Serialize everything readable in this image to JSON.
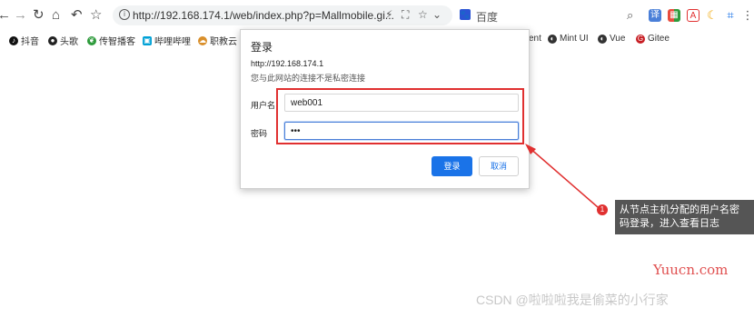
{
  "toolbar": {
    "url": "http://192.168.174.1/web/index.php?p=Mallmobile.gi...",
    "search_text": "百度"
  },
  "bookmarks": [
    {
      "label": "抖音",
      "color": "#111111",
      "icon": "douyin-icon"
    },
    {
      "label": "头歌",
      "color": "#222222",
      "icon": "github-icon"
    },
    {
      "label": "传智播客",
      "color": "#2e9b3c",
      "icon": "leaf-icon"
    },
    {
      "label": "哔哩哔哩",
      "color": "#00a1d6",
      "icon": "bilibili-icon"
    },
    {
      "label": "职教云",
      "color": "#d98f2b",
      "icon": "cloud-icon"
    },
    {
      "label": "ent",
      "color": "#333333",
      "icon": ""
    },
    {
      "label": "Mint UI",
      "color": "#333333",
      "icon": "globe-icon"
    },
    {
      "label": "Vue",
      "color": "#333333",
      "icon": "globe-icon"
    },
    {
      "label": "Gitee",
      "color": "#c71d23",
      "icon": "gitee-icon"
    }
  ],
  "dialog": {
    "title": "登录",
    "url": "http://192.168.174.1",
    "warning": "您与此网站的连接不是私密连接",
    "username_label": "用户名",
    "username_value": "web001",
    "password_label": "密码",
    "password_value": "•••",
    "login_button": "登录",
    "cancel_button": "取消"
  },
  "annotation": {
    "badge": "1",
    "line1": "从节点主机分配的用户名密",
    "line2": "码登录，进入查看日志",
    "accent": "#e03030"
  },
  "watermarks": {
    "site": "Yuucn.com",
    "author": "CSDN @啦啦啦我是偷菜的小行家"
  }
}
